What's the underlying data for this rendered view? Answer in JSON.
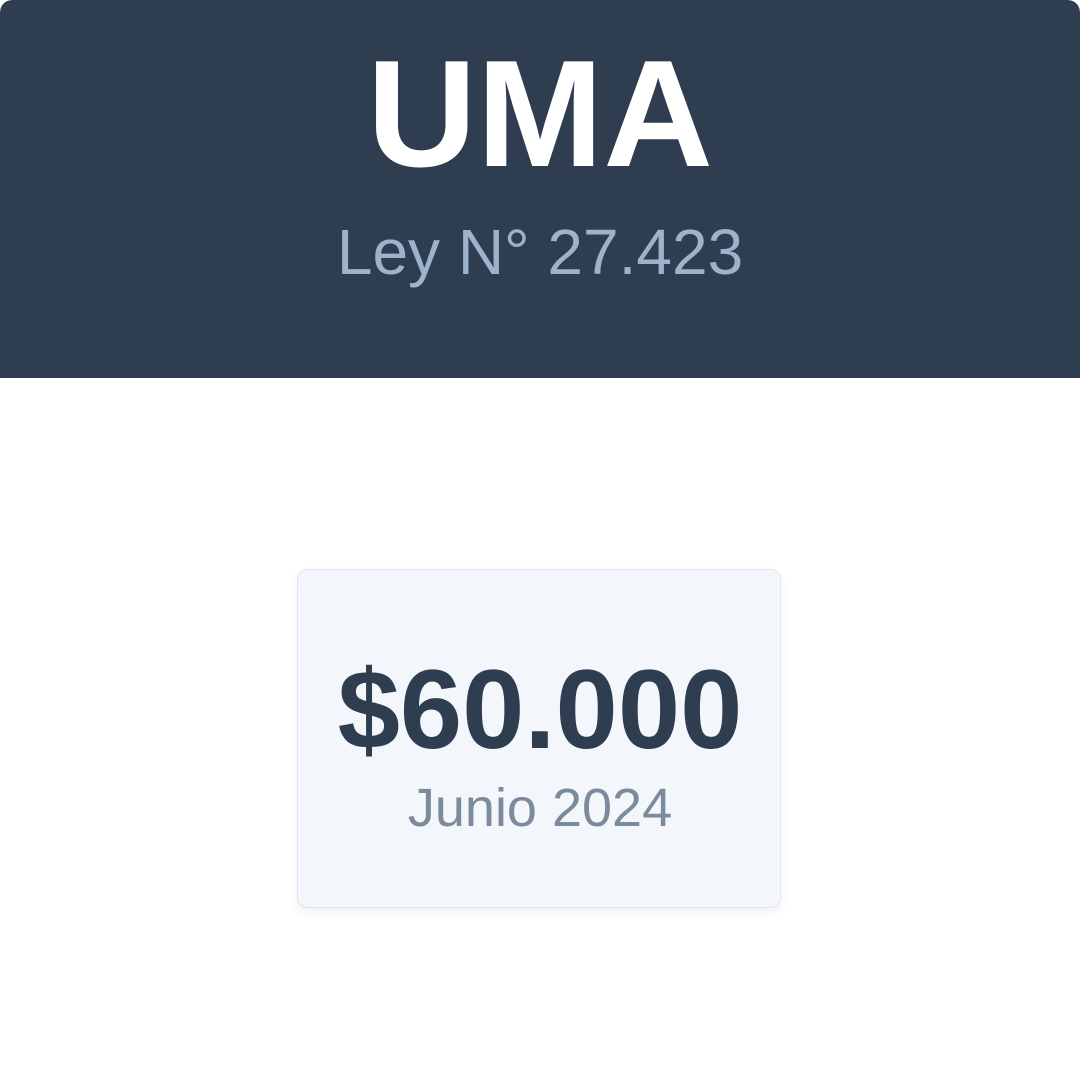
{
  "header": {
    "title": "UMA",
    "subtitle": "Ley N° 27.423"
  },
  "value_card": {
    "amount": "$60.000",
    "period": "Junio 2024"
  },
  "colors": {
    "header_background": "#2e3e50",
    "title_text": "#ffffff",
    "subtitle_text": "#9db3cc",
    "card_background": "#f3f6fa",
    "amount_text": "#2e3e50",
    "period_text": "#7b8a9c"
  }
}
